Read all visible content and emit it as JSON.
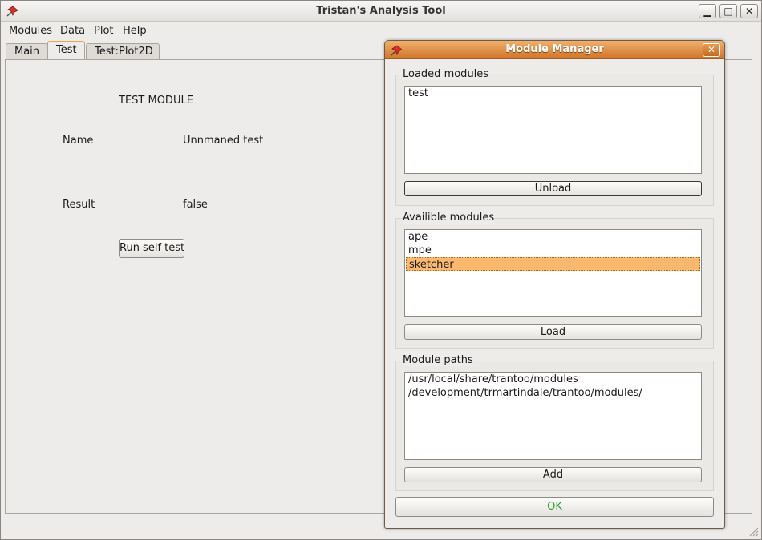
{
  "window": {
    "title": "Tristan's Analysis Tool",
    "minimize_label": "▁",
    "maximize_label": "□",
    "close_label": "✕"
  },
  "menu": [
    "Modules",
    "Data",
    "Plot",
    "Help"
  ],
  "tabs": [
    {
      "label": "Main"
    },
    {
      "label": "Test"
    },
    {
      "label": "Test:Plot2D"
    }
  ],
  "test_panel": {
    "heading": "TEST MODULE",
    "name_label": "Name",
    "name_value": "Unnmaned test",
    "result_label": "Result",
    "result_value": "false",
    "run_button": "Run self test"
  },
  "dialog": {
    "title": "Module Manager",
    "close_label": "✕",
    "loaded": {
      "title": "Loaded modules",
      "items": [
        "test"
      ],
      "button": "Unload"
    },
    "available": {
      "title": "Availible modules",
      "items": [
        "ape",
        "mpe",
        "sketcher"
      ],
      "selected": "sketcher",
      "button": "Load"
    },
    "paths": {
      "title": "Module paths",
      "items": [
        "/usr/local/share/trantoo/modules",
        "/development/trmartindale/trantoo/modules/"
      ],
      "button": "Add"
    },
    "ok_button": "OK"
  },
  "colors": {
    "accent": "#f0a050",
    "dialog_titlebar": "#d0762a",
    "selection": "#fbb970",
    "ok_text": "#2e9b2e"
  },
  "icons": {
    "app": "pushpin-icon",
    "resize": "resize-grip-icon"
  }
}
